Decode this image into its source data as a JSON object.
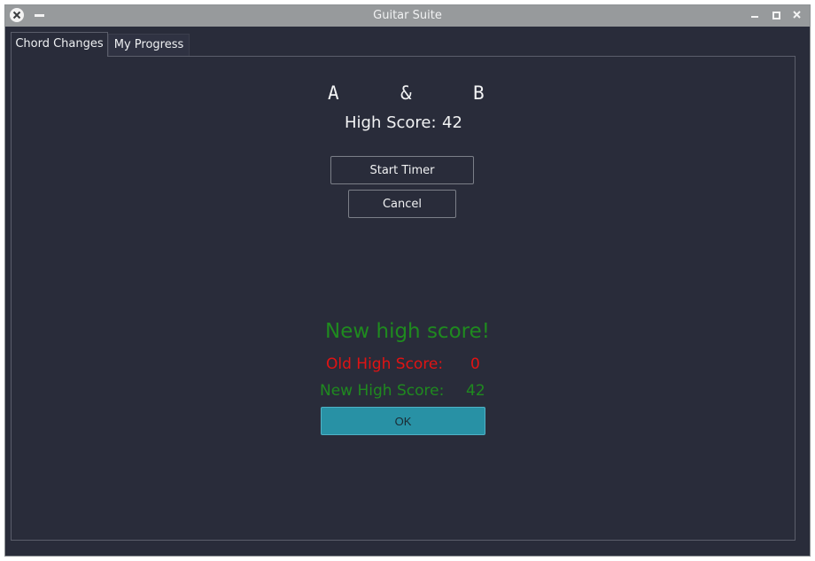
{
  "window": {
    "title": "Guitar Suite"
  },
  "tabs": [
    {
      "label": "Chord Changes"
    },
    {
      "label": "My Progress"
    }
  ],
  "chords": {
    "first": "A",
    "separator": "&",
    "second": "B"
  },
  "high_score": {
    "label": "High Score:",
    "value": "42"
  },
  "buttons": {
    "start_timer": "Start Timer",
    "cancel": "Cancel",
    "ok": "OK"
  },
  "result": {
    "headline": "New high score!",
    "old_label": "Old High Score:",
    "old_value": "0",
    "new_label": "New High Score:",
    "new_value": "42"
  },
  "colors": {
    "background": "#292c3a",
    "success": "#1f8a1f",
    "error": "#e11313",
    "accent": "#2891a5"
  }
}
